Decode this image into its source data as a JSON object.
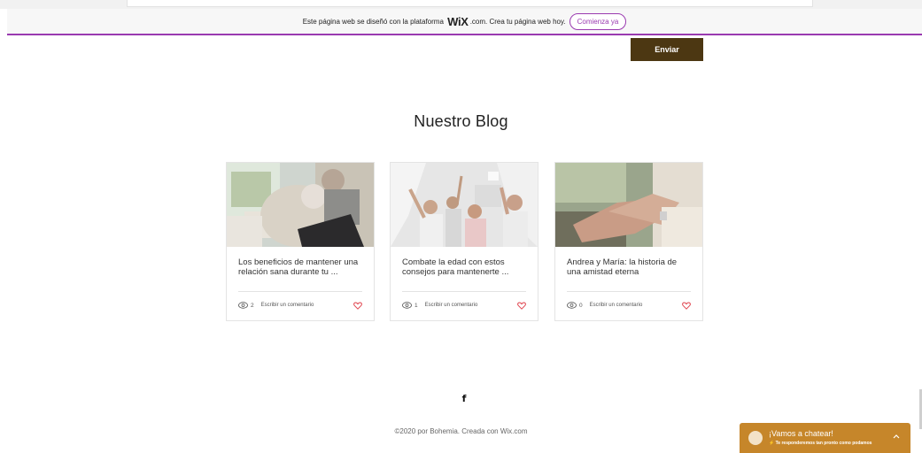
{
  "wix_banner": {
    "text_before": "Este página web se diseñó con la plataforma",
    "brand": "WiX",
    "text_after": ".com. Crea tu página web hoy.",
    "cta": "Comienza ya"
  },
  "form": {
    "submit_label": "Enviar"
  },
  "blog": {
    "title": "Nuestro Blog",
    "posts": [
      {
        "title": "Los beneficios de mantener una relación sana durante tu ...",
        "views": "2",
        "comment_label": "Escribir un comentario"
      },
      {
        "title": "Combate la edad con estos consejos para mantenerte ...",
        "views": "1",
        "comment_label": "Escribir un comentario"
      },
      {
        "title": "Andrea y María: la historia de una amistad eterna",
        "views": "0",
        "comment_label": "Escribir un comentario"
      }
    ]
  },
  "social": {
    "facebook_glyph": "f"
  },
  "footer": {
    "text": "©2020 por Bohemia. Creada con Wix.com"
  },
  "chat": {
    "title": "¡Vamos a chatear!",
    "subtitle": "Te responderemos tan pronto como podamos"
  },
  "colors": {
    "accent": "#9a3ab0",
    "button": "#4c3712",
    "chat": "#c6862a",
    "heart": "#e0454f"
  }
}
